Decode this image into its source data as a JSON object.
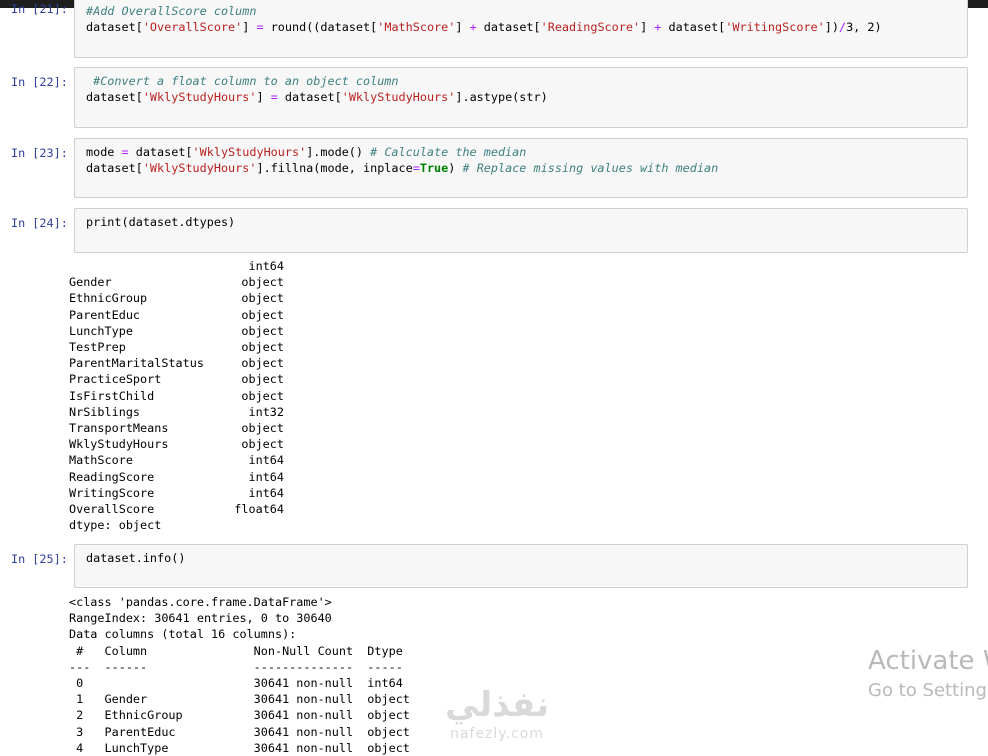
{
  "cells": [
    {
      "prompt": "In [21]:",
      "lines": [
        [
          {
            "t": "cm",
            "v": "#Add OverallScore column"
          }
        ],
        [
          {
            "t": "fn",
            "v": "dataset["
          },
          {
            "t": "str",
            "v": "'OverallScore'"
          },
          {
            "t": "fn",
            "v": "] "
          },
          {
            "t": "op",
            "v": "="
          },
          {
            "t": "fn",
            "v": " round((dataset["
          },
          {
            "t": "str",
            "v": "'MathScore'"
          },
          {
            "t": "fn",
            "v": "] "
          },
          {
            "t": "op",
            "v": "+"
          },
          {
            "t": "fn",
            "v": " dataset["
          },
          {
            "t": "str",
            "v": "'ReadingScore'"
          },
          {
            "t": "fn",
            "v": "] "
          },
          {
            "t": "op",
            "v": "+"
          },
          {
            "t": "fn",
            "v": " dataset["
          },
          {
            "t": "str",
            "v": "'WritingScore'"
          },
          {
            "t": "fn",
            "v": "])"
          },
          {
            "t": "op",
            "v": "/"
          },
          {
            "t": "fn",
            "v": "3, 2)"
          }
        ]
      ]
    },
    {
      "prompt": "In [22]:",
      "lines": [
        [
          {
            "t": "cm",
            "v": " #Convert a float column to an object column"
          }
        ],
        [
          {
            "t": "fn",
            "v": "dataset["
          },
          {
            "t": "str",
            "v": "'WklyStudyHours'"
          },
          {
            "t": "fn",
            "v": "] "
          },
          {
            "t": "op",
            "v": "="
          },
          {
            "t": "fn",
            "v": " dataset["
          },
          {
            "t": "str",
            "v": "'WklyStudyHours'"
          },
          {
            "t": "fn",
            "v": "].astype(str)"
          }
        ]
      ]
    },
    {
      "prompt": "In [23]:",
      "lines": [
        [
          {
            "t": "fn",
            "v": "mode "
          },
          {
            "t": "op",
            "v": "="
          },
          {
            "t": "fn",
            "v": " dataset["
          },
          {
            "t": "str",
            "v": "'WklyStudyHours'"
          },
          {
            "t": "fn",
            "v": "].mode() "
          },
          {
            "t": "cm",
            "v": "# Calculate the median"
          }
        ],
        [
          {
            "t": "fn",
            "v": "dataset["
          },
          {
            "t": "str",
            "v": "'WklyStudyHours'"
          },
          {
            "t": "fn",
            "v": "].fillna(mode, inplace"
          },
          {
            "t": "op",
            "v": "="
          },
          {
            "t": "kw",
            "v": "True"
          },
          {
            "t": "fn",
            "v": ") "
          },
          {
            "t": "cm",
            "v": "# Replace missing values with median"
          }
        ]
      ]
    },
    {
      "prompt": "In [24]:",
      "lines": [
        [
          {
            "t": "fn",
            "v": "print(dataset.dtypes)"
          }
        ]
      ]
    },
    {
      "prompt": "In [25]:",
      "lines": [
        [
          {
            "t": "fn",
            "v": "dataset.info()"
          }
        ]
      ]
    }
  ],
  "dtypes_output": [
    {
      "name": "",
      "type": "int64"
    },
    {
      "name": "Gender",
      "type": "object"
    },
    {
      "name": "EthnicGroup",
      "type": "object"
    },
    {
      "name": "ParentEduc",
      "type": "object"
    },
    {
      "name": "LunchType",
      "type": "object"
    },
    {
      "name": "TestPrep",
      "type": "object"
    },
    {
      "name": "ParentMaritalStatus",
      "type": "object"
    },
    {
      "name": "PracticeSport",
      "type": "object"
    },
    {
      "name": "IsFirstChild",
      "type": "object"
    },
    {
      "name": "NrSiblings",
      "type": "int32"
    },
    {
      "name": "TransportMeans",
      "type": "object"
    },
    {
      "name": "WklyStudyHours",
      "type": "object"
    },
    {
      "name": "MathScore",
      "type": "int64"
    },
    {
      "name": "ReadingScore",
      "type": "int64"
    },
    {
      "name": "WritingScore",
      "type": "int64"
    },
    {
      "name": "OverallScore",
      "type": "float64"
    }
  ],
  "dtypes_footer": "dtype: object",
  "info_output": [
    "<class 'pandas.core.frame.DataFrame'>",
    "RangeIndex: 30641 entries, 0 to 30640",
    "Data columns (total 16 columns):",
    " #   Column               Non-Null Count  Dtype ",
    "---  ------               --------------  ----- ",
    " 0                        30641 non-null  int64 ",
    " 1   Gender               30641 non-null  object",
    " 2   EthnicGroup          30641 non-null  object",
    " 3   ParentEduc           30641 non-null  object",
    " 4   LunchType            30641 non-null  object"
  ],
  "overlay": {
    "activate_title": "Activate W",
    "activate_sub": "Go to Setting",
    "watermark_ar": "نفذلي",
    "watermark_lat": "nafezly.com"
  }
}
